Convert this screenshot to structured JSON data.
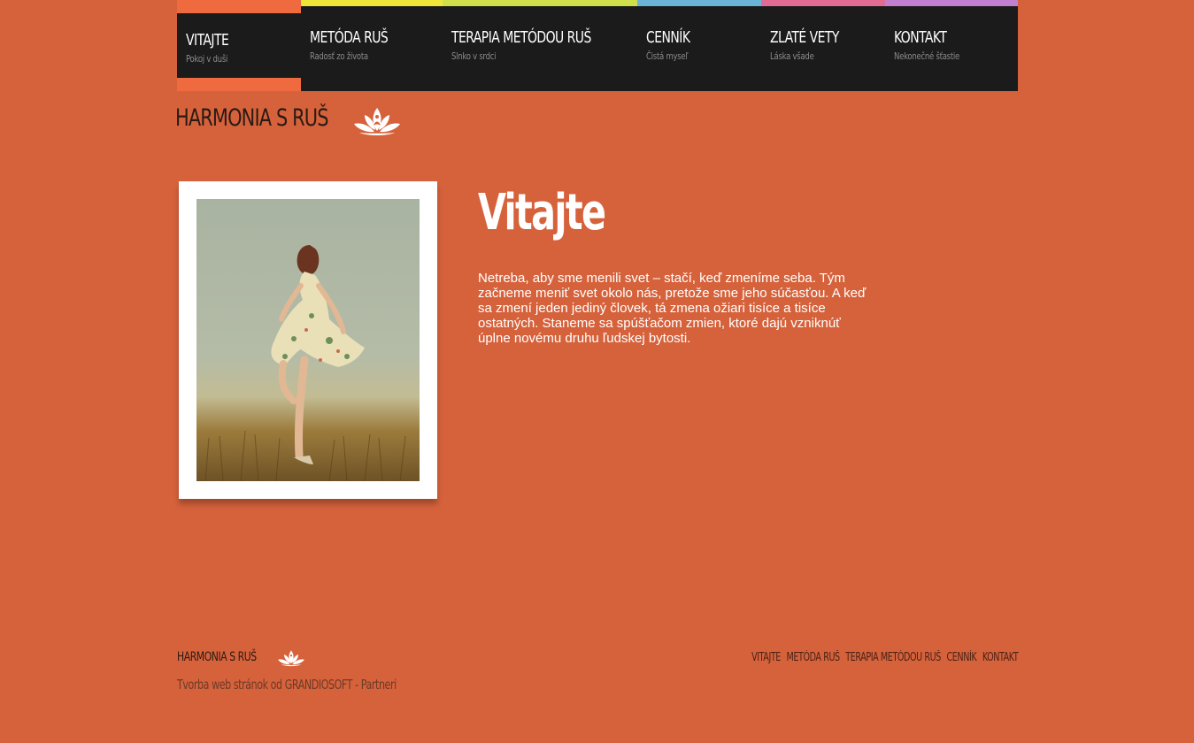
{
  "nav": {
    "items": [
      {
        "title": "VITAJTE",
        "subtitle": "Pokoj v duši",
        "color": "#ef6a3f",
        "active": true
      },
      {
        "title": "METÓDA RUŠ",
        "subtitle": "Radosť zo života",
        "color": "#f0e63a"
      },
      {
        "title": "TERAPIA METÓDOU RUŠ",
        "subtitle": "Slnko v srdci",
        "color": "#cfe04a"
      },
      {
        "title": "CENNÍK",
        "subtitle": "Čistá myseľ",
        "color": "#6ab4d8"
      },
      {
        "title": "ZLATÉ VETY",
        "subtitle": "Láska všade",
        "color": "#e06b93"
      },
      {
        "title": "KONTAKT",
        "subtitle": "Nekonečné šťastie",
        "color": "#c27fcf"
      }
    ]
  },
  "logo": {
    "text": "HARMONIA S RUŠ",
    "icon": "lotus-icon"
  },
  "main": {
    "heading": "Vitajte",
    "intro": "Netreba, aby sme menili svet – stačí, keď zmeníme seba. Tým začneme meniť svet okolo nás, pretože sme jeho súčasťou. A keď sa zmení jeden jediný človek, tá zmena ožiari tisíce a tisíce ostatných. Staneme sa spúšťačom zmien, ktoré dajú vzniknúť úplne novému druhu ľudskej bytosti."
  },
  "footer": {
    "logo_text": "HARMONIA S RUŠ",
    "credit_prefix": "Tvorba web stránok od ",
    "credit_company": "GRANDIOSOFT",
    "credit_separator": " - ",
    "credit_partners": "Partneri",
    "links": [
      "VITAJTE",
      "METÓDA RUŠ",
      "TERAPIA METÓDOU RUŠ",
      "CENNÍK",
      "KONTAKT"
    ]
  },
  "colors": {
    "background": "#d6623b",
    "nav_bg": "#1b1b1b",
    "accent": "#ef6a3f"
  }
}
